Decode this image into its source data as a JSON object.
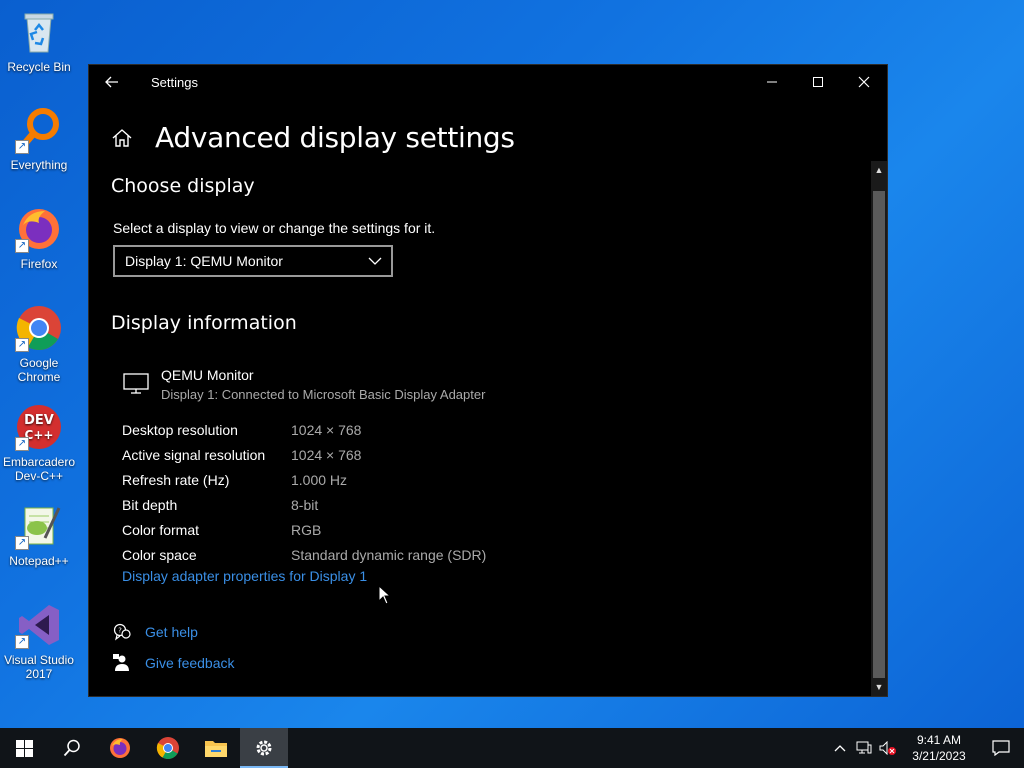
{
  "desktop": {
    "icons": [
      {
        "label": "Recycle Bin",
        "icon": "recycle-bin-icon"
      },
      {
        "label": "Everything",
        "icon": "everything-search-icon"
      },
      {
        "label": "Firefox",
        "icon": "firefox-icon"
      },
      {
        "label": "Google Chrome",
        "icon": "chrome-icon"
      },
      {
        "label": "Embarcadero Dev-C++",
        "icon": "devcpp-icon"
      },
      {
        "label": "Notepad++",
        "icon": "notepadpp-icon"
      },
      {
        "label": "Visual Studio 2017",
        "icon": "visual-studio-icon"
      }
    ]
  },
  "window": {
    "title": "Settings",
    "page_title": "Advanced display settings",
    "choose_display": {
      "heading": "Choose display",
      "description": "Select a display to view or change the settings for it.",
      "selected": "Display 1: QEMU Monitor"
    },
    "display_info": {
      "heading": "Display information",
      "monitor_name": "QEMU Monitor",
      "monitor_sub": "Display 1: Connected to Microsoft Basic Display Adapter",
      "rows": [
        {
          "label": "Desktop resolution",
          "value": "1024 × 768"
        },
        {
          "label": "Active signal resolution",
          "value": "1024 × 768"
        },
        {
          "label": "Refresh rate (Hz)",
          "value": "1.000 Hz"
        },
        {
          "label": "Bit depth",
          "value": "8-bit"
        },
        {
          "label": "Color format",
          "value": "RGB"
        },
        {
          "label": "Color space",
          "value": "Standard dynamic range (SDR)"
        }
      ],
      "adapter_link": "Display adapter properties for Display 1"
    },
    "help": {
      "get_help": "Get help",
      "give_feedback": "Give feedback"
    }
  },
  "taskbar": {
    "time": "9:41 AM",
    "date": "3/21/2023"
  },
  "colors": {
    "link": "#3a8fe6",
    "accent": "#7ab8f5"
  }
}
